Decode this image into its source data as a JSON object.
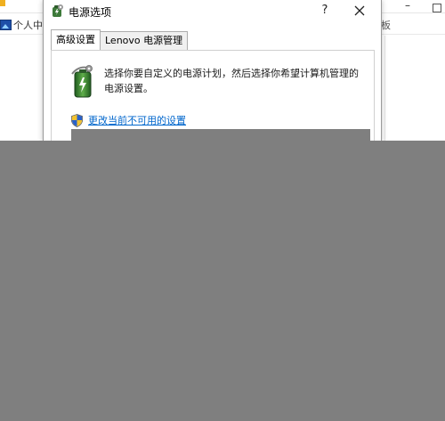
{
  "background_window": {
    "bookmark_label": "个人中",
    "right_text": "板"
  },
  "dialog": {
    "title": "电源选项",
    "help_label": "?",
    "tabs": [
      {
        "label": "高级设置",
        "active": true
      },
      {
        "label": "Lenovo 电源管理",
        "active": false
      }
    ],
    "intro_text": "选择你要自定义的电源计划，然后选择你希望计算机管理的电源设置。",
    "uac_link_text": "更改当前不可用的设置",
    "expand_glyph": "»"
  },
  "icons": {
    "title": "power-options-icon",
    "close": "close-icon",
    "battery": "battery-plan-icon",
    "shield": "uac-shield-icon",
    "bookmark": "image-bookmark-icon"
  },
  "colors": {
    "link": "#0066cc",
    "overlay": "#7f7f7f",
    "tab_border": "#adadad"
  }
}
